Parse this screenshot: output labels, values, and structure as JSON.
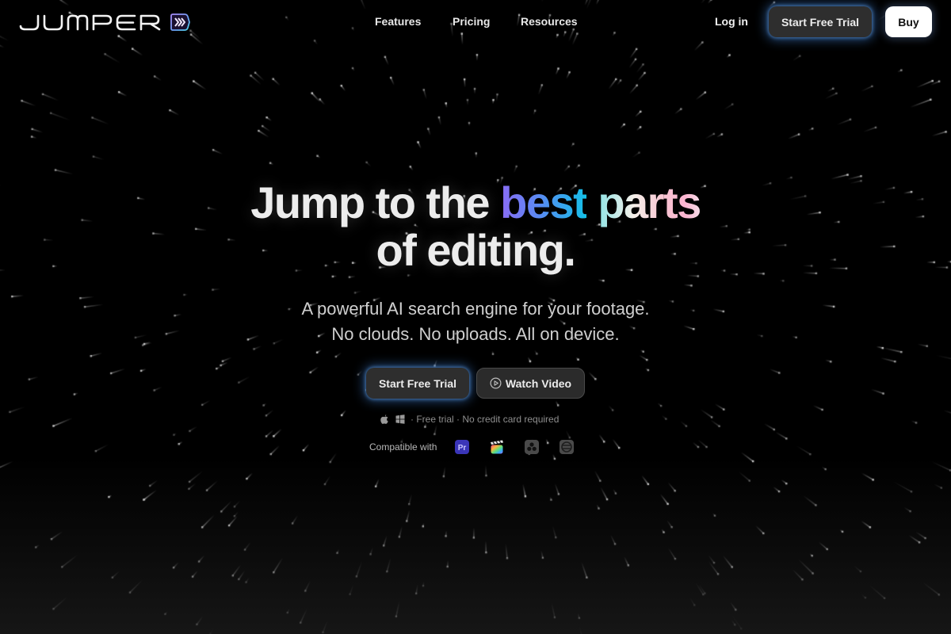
{
  "nav": {
    "logo_text": "JUMPER",
    "links": [
      {
        "label": "Features"
      },
      {
        "label": "Pricing"
      },
      {
        "label": "Resources"
      }
    ],
    "login_label": "Log in",
    "trial_label": "Start Free Trial",
    "buy_label": "Buy"
  },
  "hero": {
    "headline_part1": "Jump to the ",
    "headline_highlight1": "best",
    "headline_space": " ",
    "headline_highlight2": "parts",
    "headline_line2": "of editing.",
    "subtitle_line1": "A powerful AI search engine for your footage.",
    "subtitle_line2": "No clouds. No uploads. All on device.",
    "cta_primary": "Start Free Trial",
    "cta_secondary": "Watch Video",
    "cta_secondary_icon": "play-circle-icon",
    "note_platforms": [
      "apple-icon",
      "windows-icon"
    ],
    "note_text": "· Free trial · No credit card required",
    "compat_label": "Compatible with",
    "compat_apps": [
      {
        "name": "Adobe Premiere Pro",
        "icon": "premiere-pro-icon",
        "abbr": "Pr"
      },
      {
        "name": "Final Cut Pro",
        "icon": "final-cut-pro-icon"
      },
      {
        "name": "DaVinci Resolve",
        "icon": "davinci-resolve-icon"
      },
      {
        "name": "Avid / other editor",
        "icon": "editor-app-icon"
      }
    ]
  },
  "colors": {
    "background": "#000000",
    "glow": "#468ce6",
    "gradient_best": [
      "#8a6cf5",
      "#5a8af3",
      "#14c0e8"
    ],
    "gradient_parts": [
      "#8fe4e6",
      "#f5efe9",
      "#f8c4d2",
      "#fbb4d0"
    ],
    "premiere_bg": "#3a35b8"
  }
}
